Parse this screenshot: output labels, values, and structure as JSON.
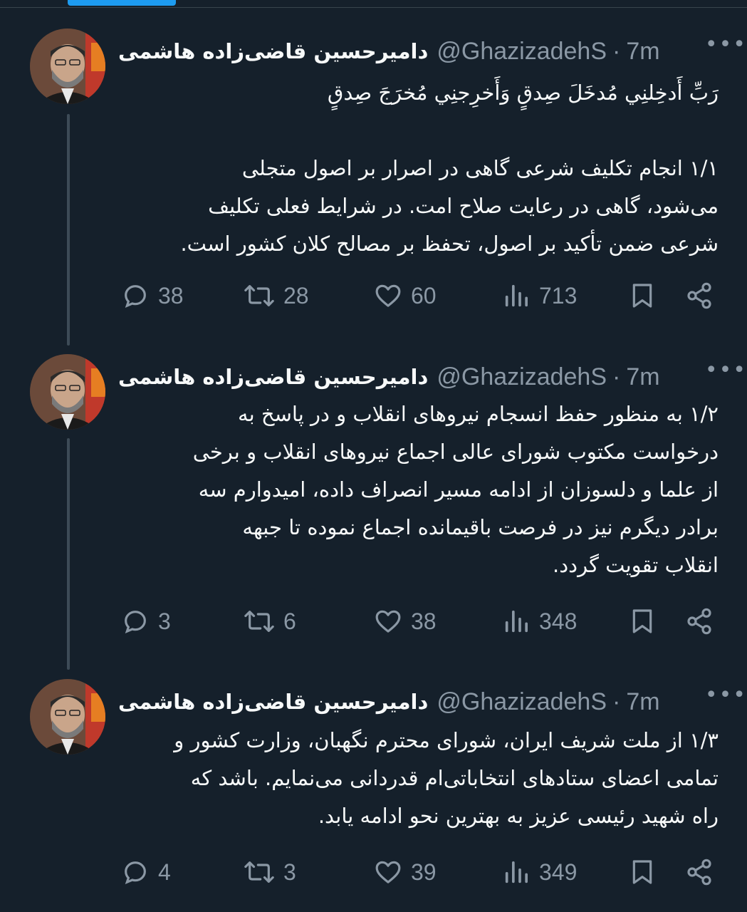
{
  "tweets": [
    {
      "author_name": "دامیرحسین قاضی‌زاده هاشمی",
      "handle": "@GhazizadehS",
      "time": "7m",
      "more_label": "•••",
      "body": [
        "رَبِّ أَدخِلنِي مُدخَلَ صِدقٍ وَأَخرِجنِي مُخرَجَ صِدقٍ",
        "",
        "۱/۱ انجام تکلیف شرعی گاهی در اصرار بر اصول متجلی",
        "می‌شود، گاهی در رعایت صلاح امت. در شرایط فعلی تکلیف",
        "شرعی ضمن تأکید بر اصول، تحفظ بر مصالح کلان کشور است."
      ],
      "replies": "38",
      "retweets": "28",
      "likes": "60",
      "views": "713"
    },
    {
      "author_name": "دامیرحسین قاضی‌زاده هاشمی",
      "handle": "@GhazizadehS",
      "time": "7m",
      "more_label": "•••",
      "body": [
        "۱/۲ به منظور حفظ انسجام نیروهای انقلاب و در پاسخ به",
        "درخواست مکتوب شورای عالی اجماع نیروهای انقلاب و برخی",
        "از علما و دلسوزان از ادامه مسیر انصراف داده، امیدوارم سه",
        "برادر دیگرم نیز در فرصت باقیمانده اجماع نموده تا جبهه",
        "انقلاب تقویت گردد."
      ],
      "replies": "3",
      "retweets": "6",
      "likes": "38",
      "views": "348"
    },
    {
      "author_name": "دامیرحسین قاضی‌زاده هاشمی",
      "handle": "@GhazizadehS",
      "time": "7m",
      "more_label": "•••",
      "body": [
        "۱/۳ از ملت شریف ایران، شورای محترم نگهبان، وزارت کشور و",
        "تمامی اعضای ستادهای انتخاباتی‌ام قدردانی می‌نمایم. باشد که",
        "راه شهید رئیسی عزیز به بهترین نحو ادامه یابد."
      ],
      "replies": "4",
      "retweets": "3",
      "likes": "39",
      "views": "349"
    }
  ],
  "separator": "·",
  "colors": {
    "background": "#15202b",
    "text": "#f7f9f9",
    "muted": "#8b98a5",
    "accent": "#1d9bf0",
    "thread_line": "#3d4b57"
  },
  "icons": [
    "reply-icon",
    "retweet-icon",
    "like-icon",
    "views-icon",
    "bookmark-icon",
    "share-icon",
    "avatar-photo"
  ]
}
